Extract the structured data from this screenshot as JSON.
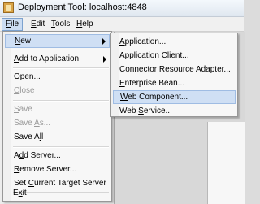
{
  "window": {
    "title": "Deployment Tool: localhost:4848"
  },
  "menubar": [
    {
      "label": "File",
      "mnemonic": "F",
      "rest": "ile"
    },
    {
      "label": "Edit",
      "mnemonic": "E",
      "rest": "dit"
    },
    {
      "label": "Tools",
      "mnemonic": "T",
      "rest": "ools"
    },
    {
      "label": "Help",
      "mnemonic": "H",
      "rest": "elp"
    }
  ],
  "file_menu": {
    "items": [
      {
        "pre": "",
        "mn": "N",
        "post": "ew"
      },
      {
        "pre": "",
        "mn": "A",
        "post": "dd to Application"
      },
      {
        "pre": "",
        "mn": "O",
        "post": "pen..."
      },
      {
        "pre": "",
        "mn": "C",
        "post": "lose"
      },
      {
        "pre": "",
        "mn": "S",
        "post": "ave"
      },
      {
        "pre": "Save ",
        "mn": "A",
        "post": "s..."
      },
      {
        "pre": "Save A",
        "mn": "l",
        "post": "l"
      },
      {
        "pre": "A",
        "mn": "d",
        "post": "d Server..."
      },
      {
        "pre": "",
        "mn": "R",
        "post": "emove Server..."
      },
      {
        "pre": "Set ",
        "mn": "C",
        "post": "urrent Target Server"
      },
      {
        "pre": "E",
        "mn": "x",
        "post": "it"
      }
    ]
  },
  "new_submenu": {
    "items": [
      {
        "pre": "",
        "mn": "A",
        "post": "pplication..."
      },
      {
        "pre": "A",
        "mn": "p",
        "post": "plication Client..."
      },
      {
        "pre": "Connector Resource Adapter",
        "mn": "",
        "post": "..."
      },
      {
        "pre": "",
        "mn": "E",
        "post": "nterprise Bean..."
      },
      {
        "pre": "",
        "mn": "W",
        "post": "eb Component..."
      },
      {
        "pre": "Web ",
        "mn": "S",
        "post": "ervice..."
      }
    ]
  }
}
